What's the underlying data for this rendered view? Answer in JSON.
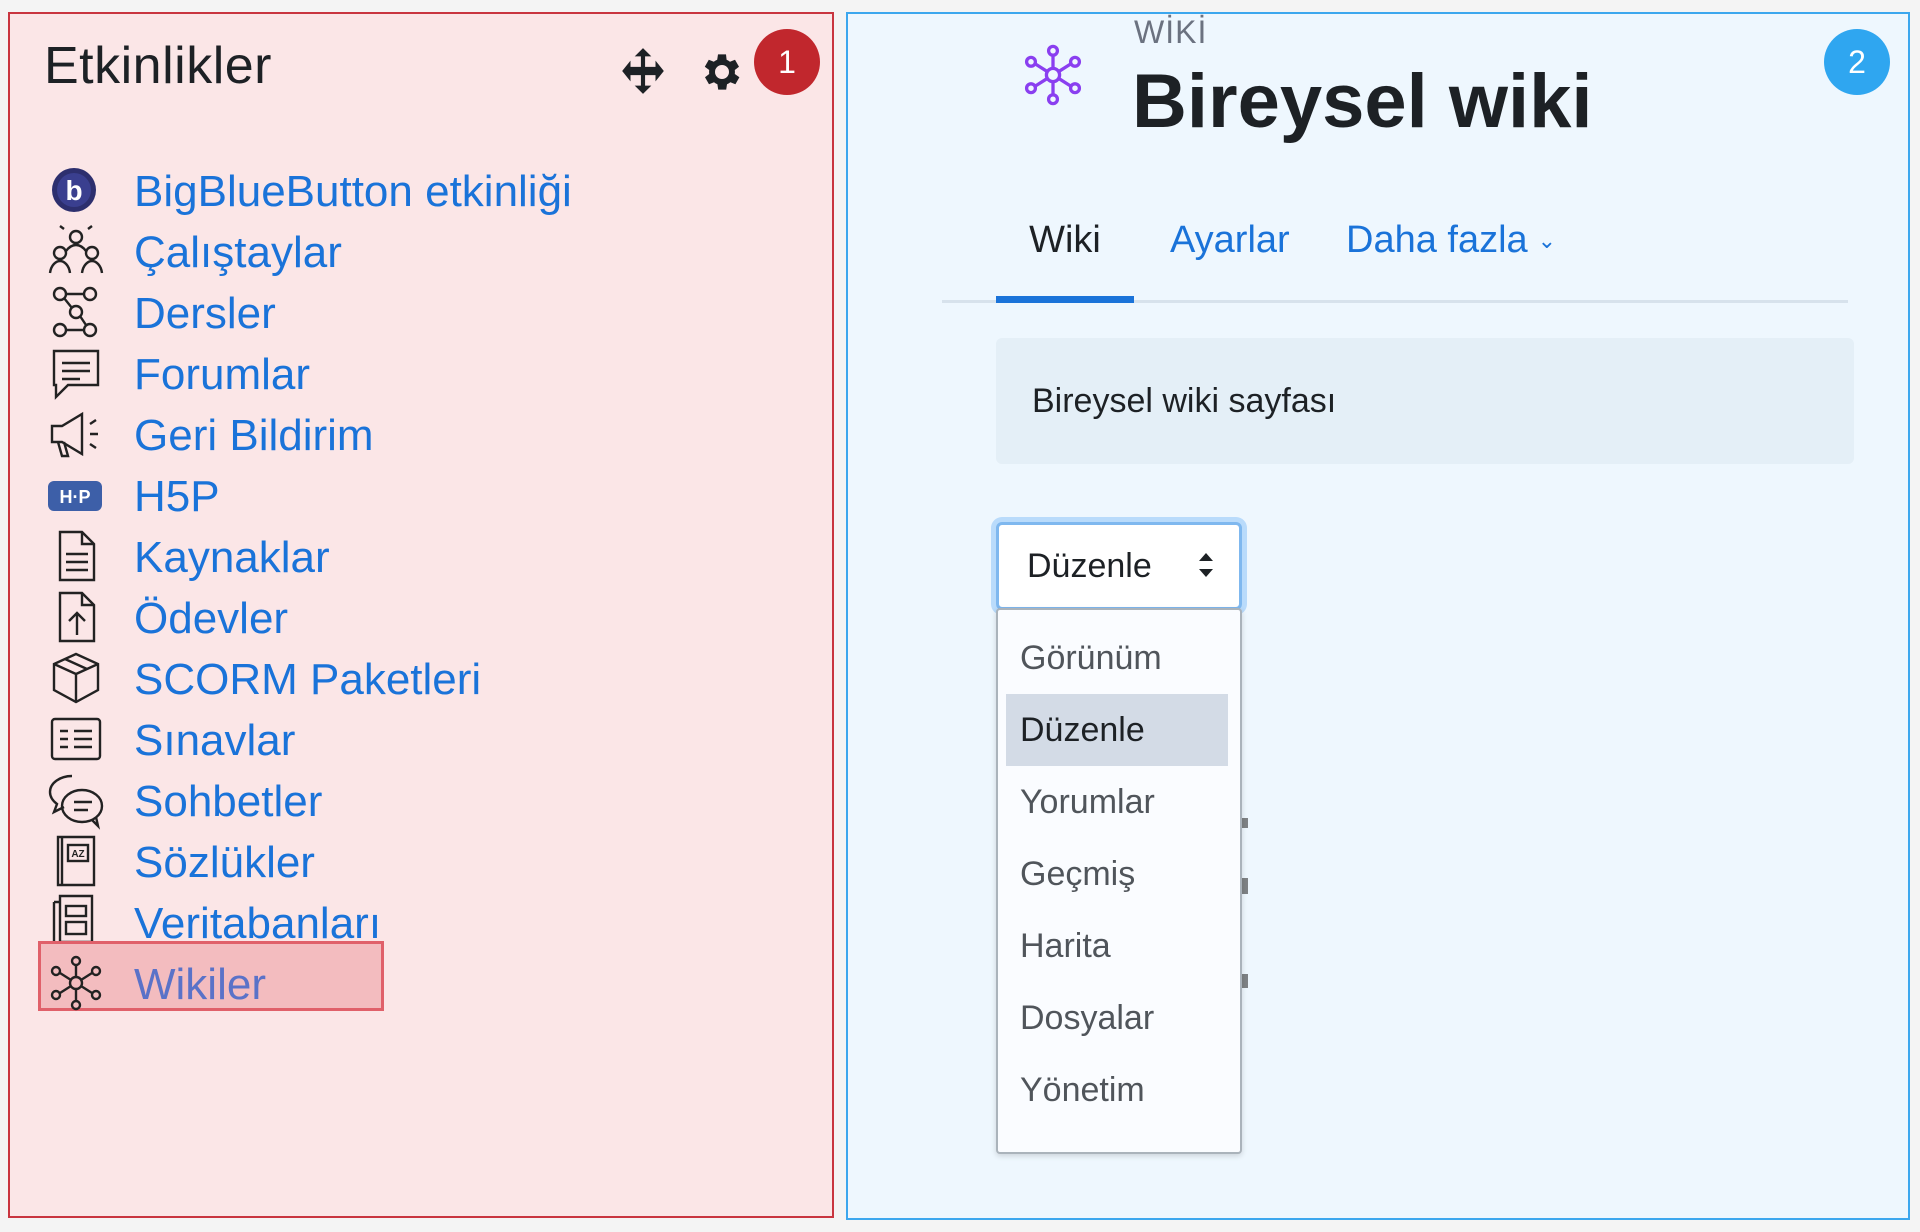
{
  "panel1": {
    "badge": "1",
    "title": "Etkinlikler",
    "controls": {
      "move_icon": "move-icon",
      "settings_icon": "gear-icon"
    },
    "activities": [
      {
        "label": "BigBlueButton etkinliği",
        "icon": "bigbluebutton-icon"
      },
      {
        "label": "Çalıştaylar",
        "icon": "workshop-icon"
      },
      {
        "label": "Dersler",
        "icon": "lesson-icon"
      },
      {
        "label": "Forumlar",
        "icon": "forum-icon"
      },
      {
        "label": "Geri Bildirim",
        "icon": "megaphone-icon"
      },
      {
        "label": "H5P",
        "icon": "h5p-icon"
      },
      {
        "label": "Kaynaklar",
        "icon": "document-icon"
      },
      {
        "label": "Ödevler",
        "icon": "upload-icon"
      },
      {
        "label": "SCORM Paketleri",
        "icon": "package-icon"
      },
      {
        "label": "Sınavlar",
        "icon": "quiz-icon"
      },
      {
        "label": "Sohbetler",
        "icon": "chat-icon"
      },
      {
        "label": "Sözlükler",
        "icon": "glossary-icon"
      },
      {
        "label": "Veritabanları",
        "icon": "database-icon"
      },
      {
        "label": "Wikiler",
        "icon": "wiki-icon",
        "selected": true
      }
    ]
  },
  "panel2": {
    "badge": "2",
    "kicker": "WİKİ",
    "title": "Bireysel wiki",
    "logo_icon": "wiki-icon",
    "tabs": [
      {
        "label": "Wiki",
        "active": true
      },
      {
        "label": "Ayarlar"
      },
      {
        "label": "Daha fazla",
        "has_dropdown": true
      }
    ],
    "description": "Bireysel wiki sayfası",
    "mode_select": {
      "value": "Düzenle",
      "options": [
        "Görünüm",
        "Düzenle",
        "Yorumlar",
        "Geçmiş",
        "Harita",
        "Dosyalar",
        "Yönetim"
      ],
      "selected_index": 1
    }
  },
  "colors": {
    "link_blue": "#1a73d9",
    "panel1_bg": "#fbe6e7",
    "panel1_border": "#c9353f",
    "panel2_bg": "#eef7fe",
    "panel2_border": "#3ca7ee",
    "badge1": "#c1272d",
    "badge2": "#2fa6f0"
  }
}
